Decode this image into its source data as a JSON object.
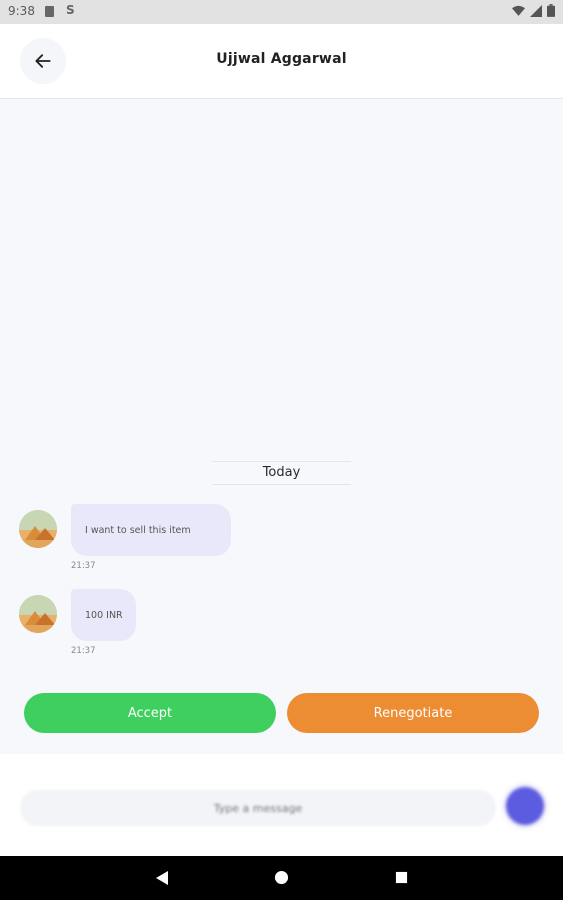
{
  "status_bar": {
    "time": "9:38"
  },
  "header": {
    "title": "Ujjwal Aggarwal"
  },
  "chat": {
    "date_separator": "Today",
    "messages": [
      {
        "text": "I want to sell this item",
        "time": "21:37"
      },
      {
        "text": "100 INR",
        "time": "21:37"
      }
    ]
  },
  "actions": {
    "accept_label": "Accept",
    "renegotiate_label": "Renegotiate"
  },
  "composer": {
    "placeholder": "Type a message"
  },
  "colors": {
    "accept": "#3ecf5f",
    "renegotiate": "#ec8d33",
    "bubble": "#e8e8fa",
    "send": "#5c5ce0",
    "background": "#f6f8fc"
  },
  "icons": {
    "back": "arrow-left-icon",
    "send": "send-icon",
    "wifi": "wifi-icon",
    "signal": "signal-icon",
    "battery": "battery-icon"
  }
}
